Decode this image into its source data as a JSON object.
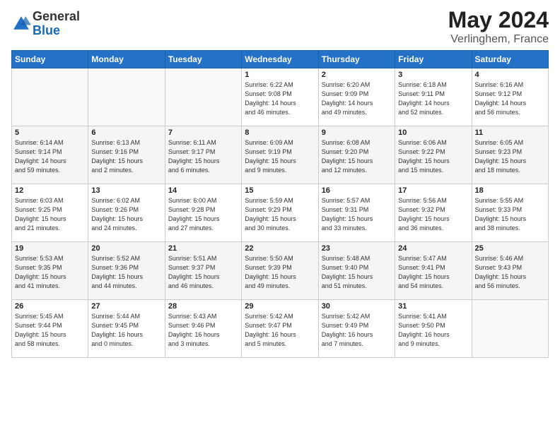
{
  "logo": {
    "general": "General",
    "blue": "Blue"
  },
  "title": {
    "month_year": "May 2024",
    "location": "Verlinghem, France"
  },
  "days_of_week": [
    "Sunday",
    "Monday",
    "Tuesday",
    "Wednesday",
    "Thursday",
    "Friday",
    "Saturday"
  ],
  "weeks": [
    [
      {
        "day": "",
        "info": ""
      },
      {
        "day": "",
        "info": ""
      },
      {
        "day": "",
        "info": ""
      },
      {
        "day": "1",
        "info": "Sunrise: 6:22 AM\nSunset: 9:08 PM\nDaylight: 14 hours\nand 46 minutes."
      },
      {
        "day": "2",
        "info": "Sunrise: 6:20 AM\nSunset: 9:09 PM\nDaylight: 14 hours\nand 49 minutes."
      },
      {
        "day": "3",
        "info": "Sunrise: 6:18 AM\nSunset: 9:11 PM\nDaylight: 14 hours\nand 52 minutes."
      },
      {
        "day": "4",
        "info": "Sunrise: 6:16 AM\nSunset: 9:12 PM\nDaylight: 14 hours\nand 56 minutes."
      }
    ],
    [
      {
        "day": "5",
        "info": "Sunrise: 6:14 AM\nSunset: 9:14 PM\nDaylight: 14 hours\nand 59 minutes."
      },
      {
        "day": "6",
        "info": "Sunrise: 6:13 AM\nSunset: 9:16 PM\nDaylight: 15 hours\nand 2 minutes."
      },
      {
        "day": "7",
        "info": "Sunrise: 6:11 AM\nSunset: 9:17 PM\nDaylight: 15 hours\nand 6 minutes."
      },
      {
        "day": "8",
        "info": "Sunrise: 6:09 AM\nSunset: 9:19 PM\nDaylight: 15 hours\nand 9 minutes."
      },
      {
        "day": "9",
        "info": "Sunrise: 6:08 AM\nSunset: 9:20 PM\nDaylight: 15 hours\nand 12 minutes."
      },
      {
        "day": "10",
        "info": "Sunrise: 6:06 AM\nSunset: 9:22 PM\nDaylight: 15 hours\nand 15 minutes."
      },
      {
        "day": "11",
        "info": "Sunrise: 6:05 AM\nSunset: 9:23 PM\nDaylight: 15 hours\nand 18 minutes."
      }
    ],
    [
      {
        "day": "12",
        "info": "Sunrise: 6:03 AM\nSunset: 9:25 PM\nDaylight: 15 hours\nand 21 minutes."
      },
      {
        "day": "13",
        "info": "Sunrise: 6:02 AM\nSunset: 9:26 PM\nDaylight: 15 hours\nand 24 minutes."
      },
      {
        "day": "14",
        "info": "Sunrise: 6:00 AM\nSunset: 9:28 PM\nDaylight: 15 hours\nand 27 minutes."
      },
      {
        "day": "15",
        "info": "Sunrise: 5:59 AM\nSunset: 9:29 PM\nDaylight: 15 hours\nand 30 minutes."
      },
      {
        "day": "16",
        "info": "Sunrise: 5:57 AM\nSunset: 9:31 PM\nDaylight: 15 hours\nand 33 minutes."
      },
      {
        "day": "17",
        "info": "Sunrise: 5:56 AM\nSunset: 9:32 PM\nDaylight: 15 hours\nand 36 minutes."
      },
      {
        "day": "18",
        "info": "Sunrise: 5:55 AM\nSunset: 9:33 PM\nDaylight: 15 hours\nand 38 minutes."
      }
    ],
    [
      {
        "day": "19",
        "info": "Sunrise: 5:53 AM\nSunset: 9:35 PM\nDaylight: 15 hours\nand 41 minutes."
      },
      {
        "day": "20",
        "info": "Sunrise: 5:52 AM\nSunset: 9:36 PM\nDaylight: 15 hours\nand 44 minutes."
      },
      {
        "day": "21",
        "info": "Sunrise: 5:51 AM\nSunset: 9:37 PM\nDaylight: 15 hours\nand 46 minutes."
      },
      {
        "day": "22",
        "info": "Sunrise: 5:50 AM\nSunset: 9:39 PM\nDaylight: 15 hours\nand 49 minutes."
      },
      {
        "day": "23",
        "info": "Sunrise: 5:48 AM\nSunset: 9:40 PM\nDaylight: 15 hours\nand 51 minutes."
      },
      {
        "day": "24",
        "info": "Sunrise: 5:47 AM\nSunset: 9:41 PM\nDaylight: 15 hours\nand 54 minutes."
      },
      {
        "day": "25",
        "info": "Sunrise: 5:46 AM\nSunset: 9:43 PM\nDaylight: 15 hours\nand 56 minutes."
      }
    ],
    [
      {
        "day": "26",
        "info": "Sunrise: 5:45 AM\nSunset: 9:44 PM\nDaylight: 15 hours\nand 58 minutes."
      },
      {
        "day": "27",
        "info": "Sunrise: 5:44 AM\nSunset: 9:45 PM\nDaylight: 16 hours\nand 0 minutes."
      },
      {
        "day": "28",
        "info": "Sunrise: 5:43 AM\nSunset: 9:46 PM\nDaylight: 16 hours\nand 3 minutes."
      },
      {
        "day": "29",
        "info": "Sunrise: 5:42 AM\nSunset: 9:47 PM\nDaylight: 16 hours\nand 5 minutes."
      },
      {
        "day": "30",
        "info": "Sunrise: 5:42 AM\nSunset: 9:49 PM\nDaylight: 16 hours\nand 7 minutes."
      },
      {
        "day": "31",
        "info": "Sunrise: 5:41 AM\nSunset: 9:50 PM\nDaylight: 16 hours\nand 9 minutes."
      },
      {
        "day": "",
        "info": ""
      }
    ]
  ]
}
